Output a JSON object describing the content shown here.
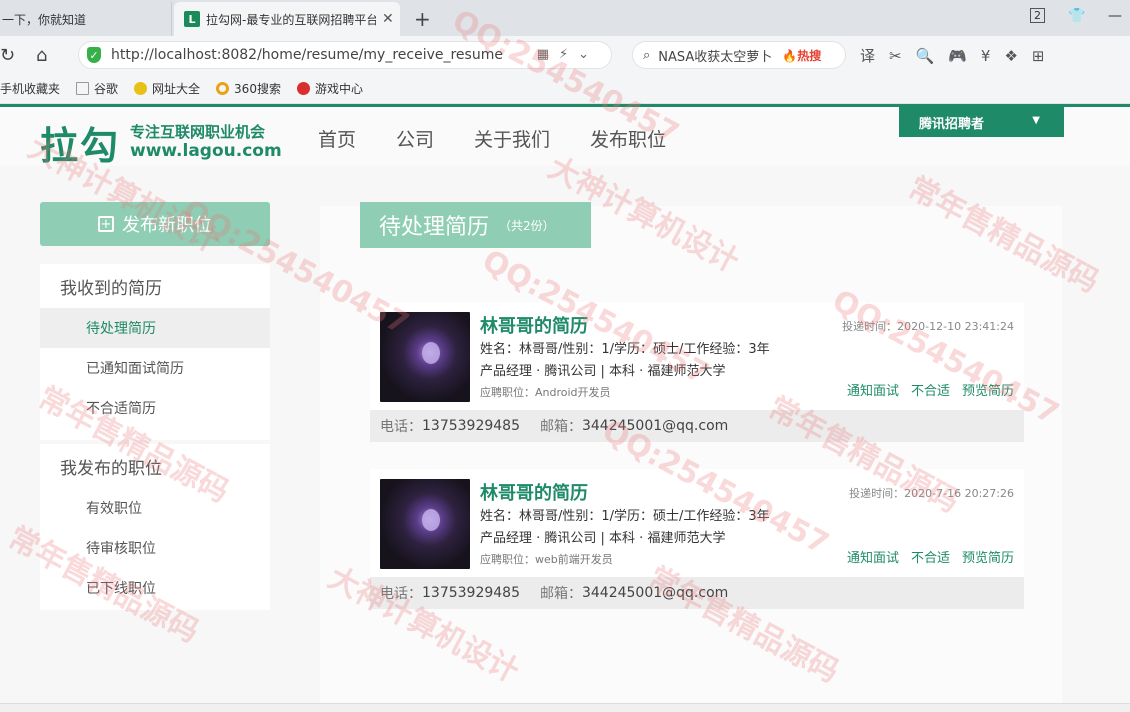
{
  "browser": {
    "tabs": [
      {
        "title": "一下，你就知道",
        "active": false
      },
      {
        "title": "拉勾网-最专业的互联网招聘平台",
        "active": true,
        "logo": "L"
      }
    ],
    "tab_count": "2",
    "url": "http://localhost:8082/home/resume/my_receive_resume",
    "search_text": "NASA收获太空萝卜",
    "search_hot": "🔥热搜",
    "bookmarks": [
      "手机收藏夹",
      "谷歌",
      "网址大全",
      "360搜索",
      "游戏中心"
    ]
  },
  "header": {
    "logo": "拉勾",
    "slogan": "专注互联网职业机会",
    "site_url": "www.lagou.com",
    "nav": [
      "首页",
      "公司",
      "关于我们",
      "发布职位"
    ],
    "user_menu": "腾讯招聘者"
  },
  "sidebar": {
    "publish_button": "发布新职位",
    "sections": [
      {
        "title": "我收到的简历",
        "items": [
          {
            "label": "待处理简历",
            "active": true
          },
          {
            "label": "已通知面试简历",
            "active": false
          },
          {
            "label": "不合适简历",
            "active": false
          }
        ]
      },
      {
        "title": "我发布的职位",
        "items": [
          {
            "label": "有效职位",
            "active": false
          },
          {
            "label": "待审核职位",
            "active": false
          },
          {
            "label": "已下线职位",
            "active": false
          }
        ]
      }
    ]
  },
  "main": {
    "title": "待处理简历",
    "count": "（共2份）",
    "resumes": [
      {
        "name": "林哥哥的简历",
        "time": "投递时间：2020-12-10 23:41:24",
        "line1": "姓名：林哥哥/性别：1/学历：硕士/工作经验：3年",
        "line2": "产品经理 · 腾讯公司 | 本科 · 福建师范大学",
        "position": "应聘职位：Android开发员",
        "actions": [
          "通知面试",
          "不合适",
          "预览简历"
        ],
        "phone_label": "电话：",
        "phone": "13753929485",
        "email_label": "邮箱：",
        "email": "344245001@qq.com"
      },
      {
        "name": "林哥哥的简历",
        "time": "投递时间：2020-7-16 20:27:26",
        "line1": "姓名：林哥哥/性别：1/学历：硕士/工作经验：3年",
        "line2": "产品经理 · 腾讯公司 | 本科 · 福建师范大学",
        "position": "应聘职位：web前端开发员",
        "actions": [
          "通知面试",
          "不合适",
          "预览简历"
        ],
        "phone_label": "电话：",
        "phone": "13753929485",
        "email_label": "邮箱：",
        "email": "344245001@qq.com"
      }
    ]
  },
  "watermark": {
    "texts": [
      "QQ:254540457",
      "常年售精品源码",
      "大神计算机设计"
    ]
  },
  "colors": {
    "brand": "#1e8a68",
    "brand_light": "#8fcdb5"
  }
}
